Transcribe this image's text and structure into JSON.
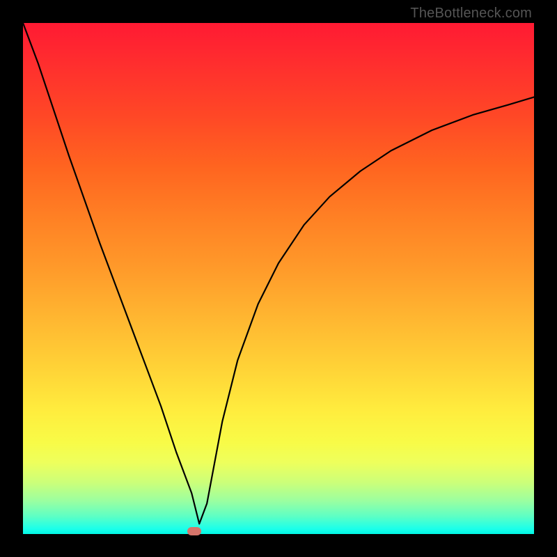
{
  "watermark": "TheBottleneck.com",
  "chart_data": {
    "type": "line",
    "title": "",
    "xlabel": "",
    "ylabel": "",
    "xlim": [
      0,
      100
    ],
    "ylim": [
      0,
      100
    ],
    "x": [
      0,
      3,
      6,
      9,
      12,
      15,
      18,
      21,
      24,
      27,
      30,
      33,
      34.5,
      36,
      39,
      42,
      46,
      50,
      55,
      60,
      66,
      72,
      80,
      88,
      95,
      100
    ],
    "values": [
      100,
      92,
      83,
      74,
      65.5,
      57,
      49,
      41,
      33,
      25,
      16,
      8,
      2,
      6,
      22,
      34,
      45,
      53,
      60.5,
      66,
      71,
      75,
      79,
      82,
      84,
      85.5
    ],
    "marker": {
      "x": 33.5,
      "y": 0.5
    },
    "background": "rainbow-vertical-red-to-green"
  },
  "colors": {
    "curve": "#000000",
    "marker": "#d6756b",
    "frame": "#000000"
  }
}
